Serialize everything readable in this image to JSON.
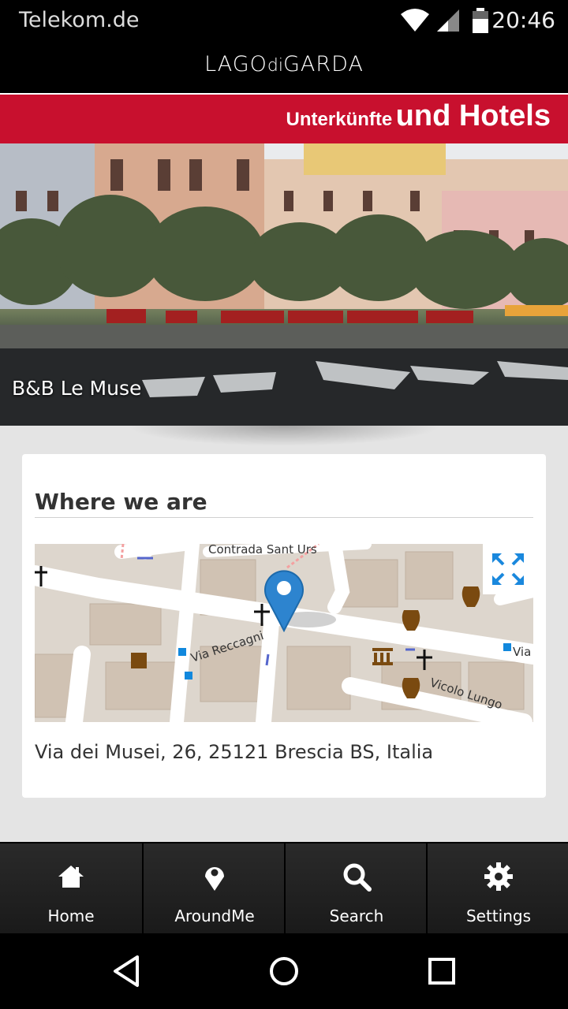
{
  "status_bar": {
    "carrier": "Telekom.de",
    "time": "20:46",
    "icons": [
      "wifi-icon",
      "signal-icon",
      "battery-icon"
    ]
  },
  "header": {
    "logo_text_1": "LAGO",
    "logo_text_2": "di",
    "logo_text_3": "GARDA"
  },
  "banner": {
    "small_text": "Unterkünfte",
    "large_text": "und Hotels",
    "color": "#c8102e"
  },
  "hero": {
    "title": "B&B Le Muse"
  },
  "card": {
    "title": "Where we are",
    "address": "Via dei Musei, 26, 25121 Brescia BS, Italia",
    "map": {
      "street_labels": [
        "Contrada Sant Urs",
        "Via Reccagni",
        "Vicolo Lungo",
        "Via"
      ],
      "expand_icon": "expand-icon",
      "marker_icon": "location-pin-icon"
    }
  },
  "bottom_nav": {
    "items": [
      {
        "label": "Home",
        "icon": "home-icon"
      },
      {
        "label": "AroundMe",
        "icon": "map-pin-icon"
      },
      {
        "label": "Search",
        "icon": "search-icon"
      },
      {
        "label": "Settings",
        "icon": "gear-icon"
      }
    ]
  },
  "system_nav": {
    "icons": [
      "back-icon",
      "home-circle-icon",
      "recents-icon"
    ]
  }
}
